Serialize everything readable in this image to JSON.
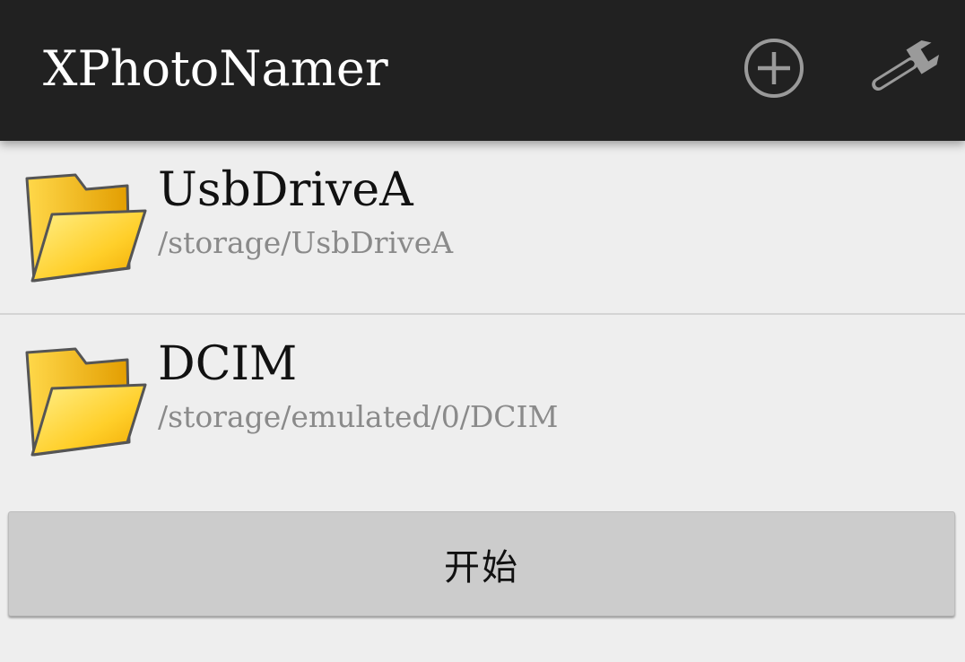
{
  "action_bar": {
    "title": "XPhotoNamer",
    "actions": [
      {
        "name": "add",
        "icon": "add-circle-icon"
      },
      {
        "name": "settings",
        "icon": "wrench-icon"
      }
    ]
  },
  "folders": [
    {
      "name": "UsbDriveA",
      "path": "/storage/UsbDriveA",
      "icon": "folder-icon"
    },
    {
      "name": "DCIM",
      "path": "/storage/emulated/0/DCIM",
      "icon": "folder-icon"
    }
  ],
  "start_button": {
    "label": "开始"
  },
  "colors": {
    "action_bar_bg": "#212121",
    "background": "#eeeeee",
    "folder_yellow": "#f5b800",
    "button_bg": "#cccccc"
  }
}
